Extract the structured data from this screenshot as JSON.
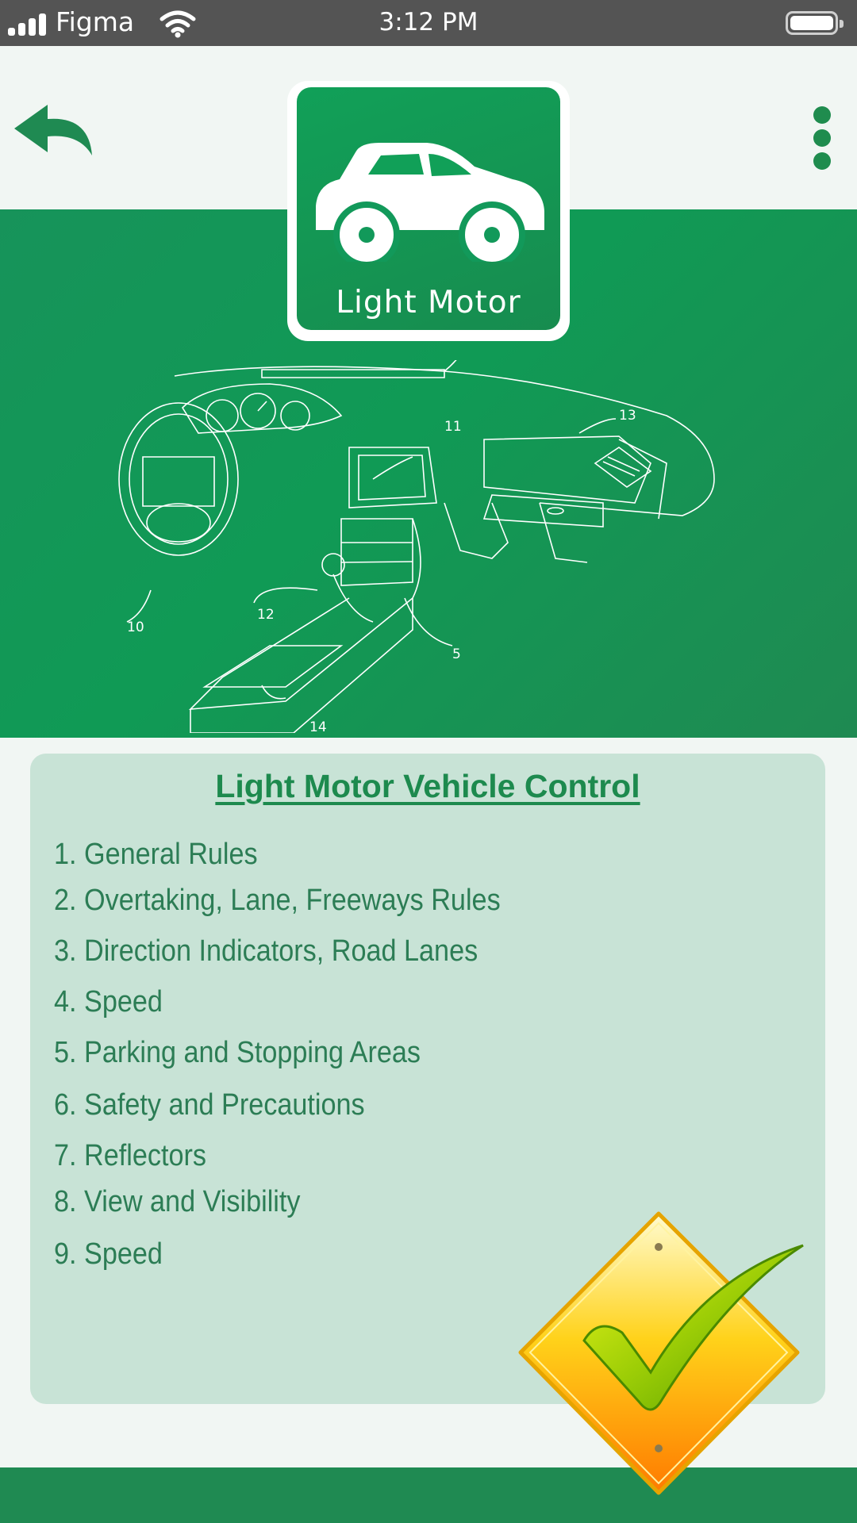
{
  "status_bar": {
    "carrier": "Figma",
    "time": "3:12 PM"
  },
  "header": {
    "back_icon": "back-arrow-icon",
    "menu_icon": "more-vertical-icon"
  },
  "category": {
    "icon": "car-icon",
    "label": "Light Motor"
  },
  "hero": {
    "image": "dashboard-line-drawing",
    "callouts": [
      "10",
      "11",
      "12",
      "13",
      "5",
      "14"
    ]
  },
  "panel": {
    "title": "Light Motor Vehicle Control",
    "items": [
      "1. General Rules",
      "2. Overtaking, Lane, Freeways Rules",
      "3. Direction Indicators, Road Lanes",
      "4. Speed",
      "5. Parking and Stopping Areas",
      "6. Safety and Precautions",
      "7. Reflectors",
      "8. View and Visibility",
      "9. Speed"
    ]
  },
  "badge": {
    "icon": "checkmark-sign-icon"
  },
  "colors": {
    "brand_green": "#1f8a52",
    "panel_bg": "#c8e3d6",
    "text_green": "#2c7d55",
    "status_bar": "#545454"
  }
}
